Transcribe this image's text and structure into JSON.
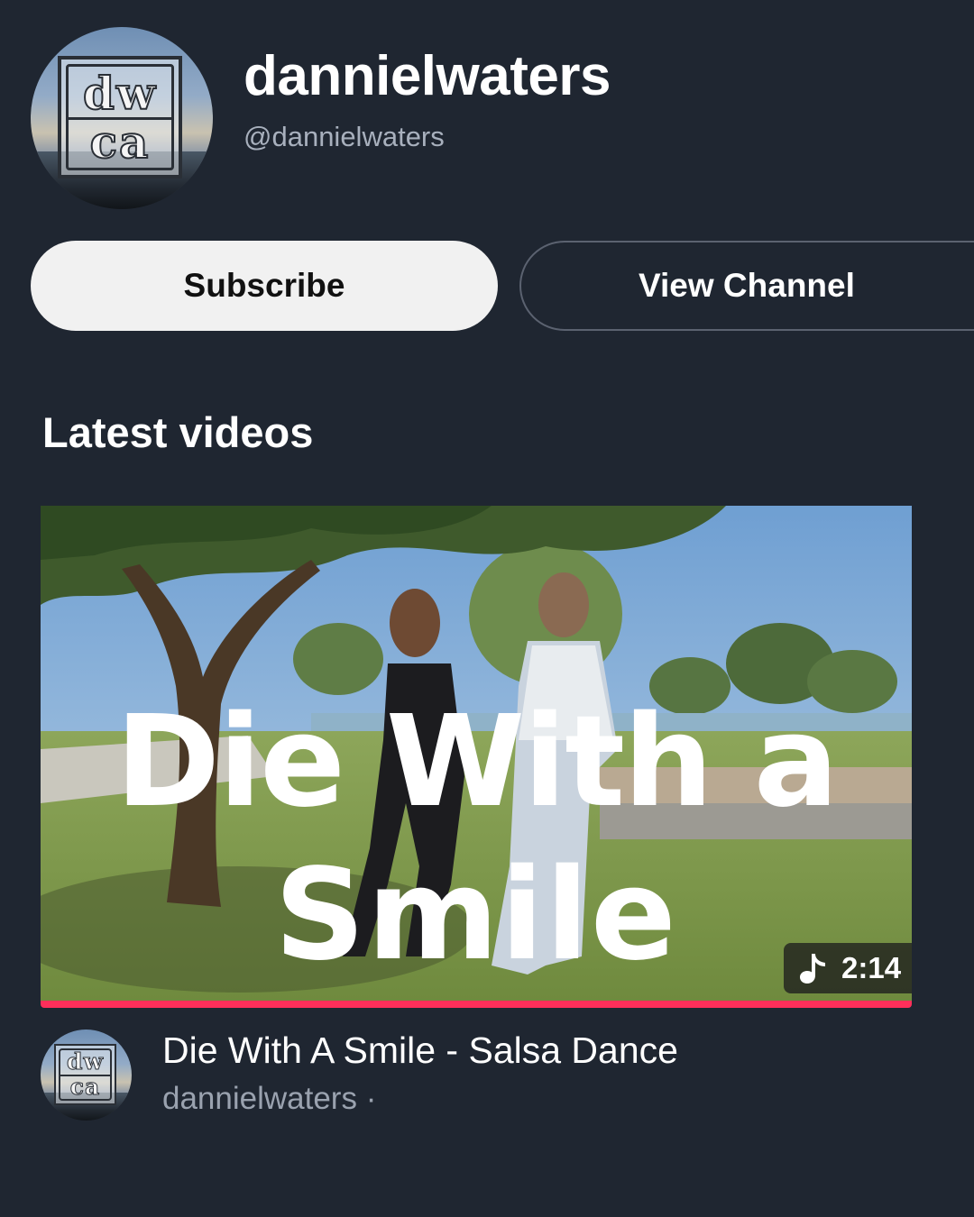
{
  "channel": {
    "name": "dannielwaters",
    "handle": "@dannielwaters",
    "avatar_logo": {
      "line1": "dw",
      "line2": "ca"
    }
  },
  "actions": {
    "subscribe_label": "Subscribe",
    "view_channel_label": "View Channel"
  },
  "section": {
    "title": "Latest videos"
  },
  "video": {
    "thumbnail_text_line1": "Die With a",
    "thumbnail_text_line2": "Smile",
    "duration": "2:14",
    "duration_icon": "music-note-icon",
    "watched_fraction": 1.0,
    "title": "Die With A Smile - Salsa Dance",
    "meta": "dannielwaters ·"
  },
  "colors": {
    "background": "#1f2631",
    "subscribe_bg": "#f1f1f1",
    "progress": "#ff2f5a",
    "secondary_text": "#a8b0bd"
  }
}
